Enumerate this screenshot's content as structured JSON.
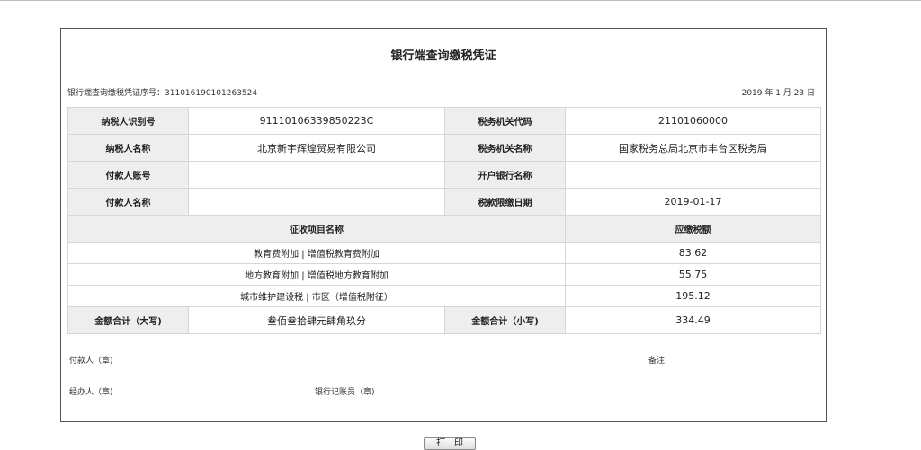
{
  "document": {
    "title": "银行端查询缴税凭证",
    "serial_label": "银行端查询缴税凭证序号：",
    "serial_number": "311016190101263524",
    "date": "2019 年 1 月 23 日"
  },
  "info": {
    "taxpayer_id_label": "纳税人识别号",
    "taxpayer_id": "91110106339850223C",
    "tax_office_code_label": "税务机关代码",
    "tax_office_code": "21101060000",
    "taxpayer_name_label": "纳税人名称",
    "taxpayer_name": "北京新宇辉煌贸易有限公司",
    "tax_office_name_label": "税务机关名称",
    "tax_office_name": "国家税务总局北京市丰台区税务局",
    "payer_account_label": "付款人账号",
    "payer_account": "",
    "bank_name_label": "开户银行名称",
    "bank_name": "",
    "payer_name_label": "付款人名称",
    "payer_name": "",
    "deadline_label": "税款限缴日期",
    "deadline": "2019-01-17"
  },
  "items_header": {
    "name": "征收项目名称",
    "amount": "应缴税额"
  },
  "items": [
    {
      "name": "教育费附加 | 增值税教育费附加",
      "amount": "83.62"
    },
    {
      "name": "地方教育附加 | 增值税地方教育附加",
      "amount": "55.75"
    },
    {
      "name": "城市维护建设税 | 市区（增值税附征）",
      "amount": "195.12"
    }
  ],
  "totals": {
    "upper_label": "金额合计（大写)",
    "upper_value": "叁佰叁拾肆元肆角玖分",
    "lower_label": "金额合计（小写)",
    "lower_value": "334.49"
  },
  "signatures": {
    "payer": "付款人（章)",
    "remark": "备注:",
    "handler": "经办人（章)",
    "bookkeeper": "银行记账员（章)"
  },
  "button": {
    "label": "打　印"
  }
}
